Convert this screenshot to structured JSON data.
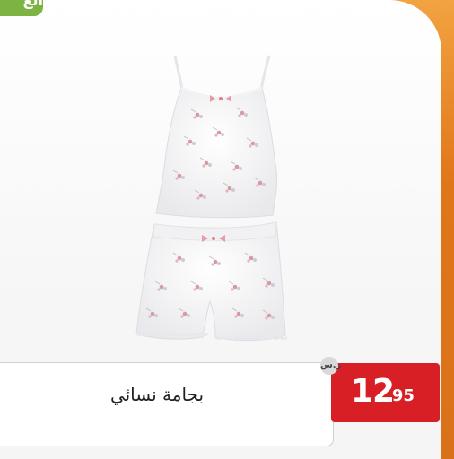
{
  "offer_tag": {
    "label": "الع"
  },
  "product": {
    "name": "بجامة نسائي",
    "image_icon": "pajama-set-image"
  },
  "price": {
    "whole": "12",
    "fraction": ".95",
    "currency_symbol": "ر.س",
    "currency_icon": "riyal-icon"
  },
  "colors": {
    "background_accent": "#e0761a",
    "price_badge": "#d81f26",
    "tag": "#7cb342"
  }
}
